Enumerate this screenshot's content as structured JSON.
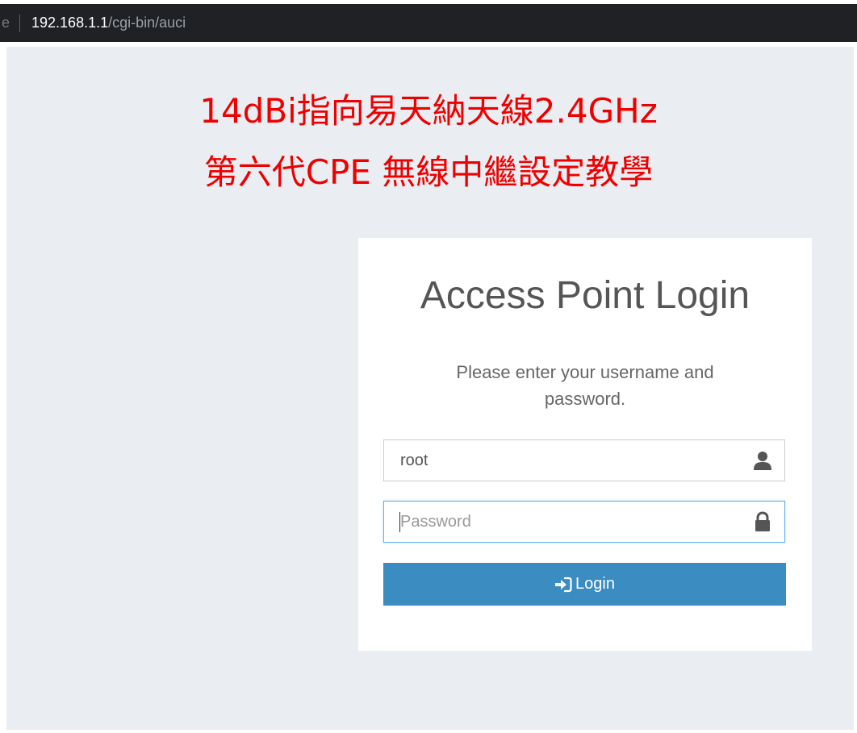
{
  "browser": {
    "address_edge": "e",
    "address_host": "192.168.1.1",
    "address_path": "/cgi-bin/auci"
  },
  "banner": {
    "line1": "14dBi指向易天納天線2.4GHz",
    "line2": "第六代CPE 無線中繼設定教學",
    "color": "#ee0000"
  },
  "login": {
    "title": "Access Point Login",
    "subtitle": "Please enter your username and password.",
    "username_value": "root",
    "password_placeholder": "Password",
    "username_icon": "user-icon",
    "password_icon": "lock-icon",
    "button_icon": "sign-in-icon",
    "button_label": "Login",
    "button_color": "#3a8cc1"
  }
}
